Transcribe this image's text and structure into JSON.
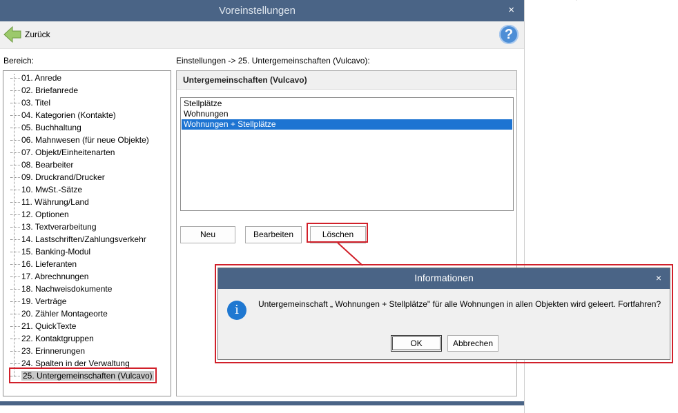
{
  "window": {
    "title": "Voreinstellungen",
    "close": "×"
  },
  "toolbar": {
    "back_label": "Zurück",
    "help": "?"
  },
  "labels": {
    "bereich": "Bereich:",
    "path": "Einstellungen -> 25. Untergemeinschaften (Vulcavo):"
  },
  "tree": {
    "items": [
      "01. Anrede",
      "02. Briefanrede",
      "03. Titel",
      "04. Kategorien (Kontakte)",
      "05. Buchhaltung",
      "06. Mahnwesen (für neue Objekte)",
      "07. Objekt/Einheitenarten",
      "08. Bearbeiter",
      "09. Druckrand/Drucker",
      "10. MwSt.-Sätze",
      "11. Währung/Land",
      "12. Optionen",
      "13. Textverarbeitung",
      "14. Lastschriften/Zahlungsverkehr",
      "15. Banking-Modul",
      "16. Lieferanten",
      "17. Abrechnungen",
      "18. Nachweisdokumente",
      "19. Verträge",
      "20. Zähler Montageorte",
      "21. QuickTexte",
      "22. Kontaktgruppen",
      "23. Erinnerungen",
      "24. Spalten in der Verwaltung",
      "25. Untergemeinschaften (Vulcavo)"
    ],
    "selected_index": 24
  },
  "panel": {
    "header": "Untergemeinschaften (Vulcavo)",
    "list": [
      "Stellplätze",
      "Wohnungen",
      "Wohnungen + Stellplätze"
    ],
    "selected_index": 2,
    "buttons": {
      "new": "Neu",
      "edit": "Bearbeiten",
      "delete": "Löschen"
    }
  },
  "dialog": {
    "title": "Informationen",
    "close": "×",
    "icon": "i",
    "message": "Untergemeinschaft „ Wohnungen + Stellplätze\" für alle Wohnungen in allen Objekten wird geleert. Fortfahren?",
    "ok": "OK",
    "cancel": "Abbrechen"
  },
  "colors": {
    "titlebar": "#4a6486",
    "highlight": "#d1202a",
    "selection": "#1d74d2"
  }
}
